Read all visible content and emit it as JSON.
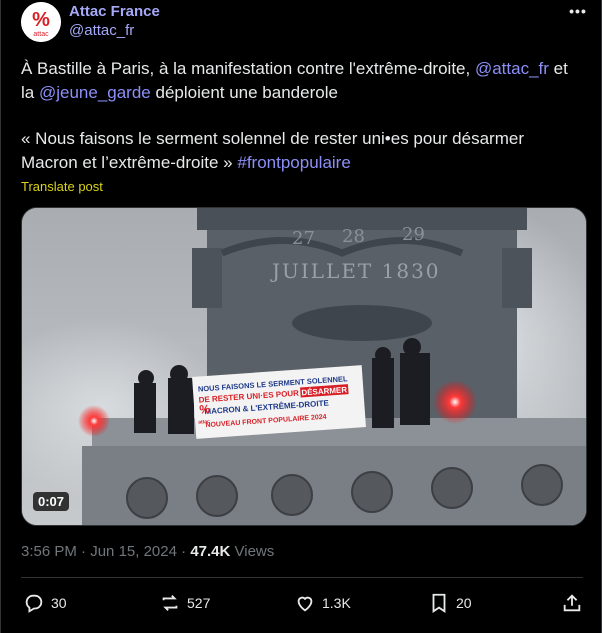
{
  "author": {
    "name": "Attac France",
    "handle": "@attac_fr",
    "avatar_text": "attac"
  },
  "post": {
    "p1_a": "À Bastille à Paris, à la manifestation contre l'extrême-droite, ",
    "p1_mention1": "@attac_fr",
    "p1_b": " et la ",
    "p1_mention2": "@jeune_garde",
    "p1_c": " déploient une banderole",
    "p2_a": "« Nous faisons le serment solennel de rester uni•es pour désarmer Macron et l’extrême-droite » ",
    "p2_hashtag": "#frontpopulaire",
    "translate": "Translate post"
  },
  "media": {
    "duration": "0:07",
    "banner_line1": "NOUS FAISONS LE SERMENT SOLENNEL",
    "banner_line2a": "DE RESTER UNI·ES POUR ",
    "banner_line2b": "DÉSARMER",
    "banner_line3": "MACRON & L'EXTRÊME-DROITE",
    "banner_line4": "NOUVEAU FRONT POPULAIRE 2024",
    "monument_text": "JUILLET 1830",
    "monument_nums": [
      "27",
      "28",
      "29"
    ],
    "banner_logo_text": "attac"
  },
  "meta": {
    "time": "3:56 PM",
    "sep": " · ",
    "date": "Jun 15, 2024",
    "sep2": " · ",
    "views_count": "47.4K",
    "views_label": " Views"
  },
  "actions": {
    "replies": "30",
    "reposts": "527",
    "likes": "1.3K",
    "bookmarks": "20"
  },
  "colors": {
    "accent": "#a6a9f8",
    "link": "#8c8ff7",
    "translate": "#d8d31a",
    "brand_red": "#d81f26"
  }
}
